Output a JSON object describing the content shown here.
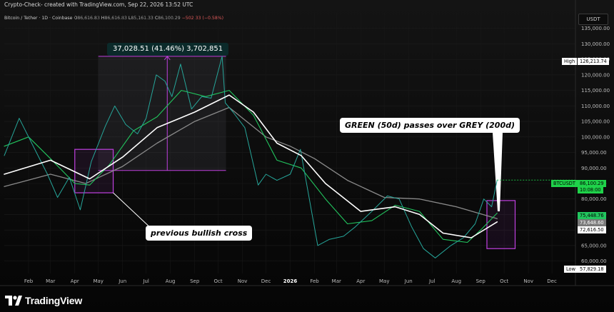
{
  "header": {
    "credit": "Crypto-Check- created with TradingView.com, Sep 22, 2026 13:52 UTC",
    "symbol": "Bitcoin / Tether · 1D · Coinbase",
    "ohlc": [
      {
        "k": "O",
        "v": "86,616.83"
      },
      {
        "k": "H",
        "v": "86,616.83"
      },
      {
        "k": "L",
        "v": "85,161.33"
      },
      {
        "k": "C",
        "v": "86,100.29"
      }
    ],
    "change": "−502.33 (−0.58%)"
  },
  "currency_label": "USDT",
  "logo_text": "TradingView",
  "colors": {
    "price": "#26a69a",
    "ma50": "#22c55e",
    "ma200": "#8a8a8a",
    "ma_white": "#ffffff",
    "magenta": "#c040e0",
    "last_price": "#1fd24a"
  },
  "price_labels": {
    "high_tag": "High",
    "high_value": "126,213.74",
    "low_tag": "Low",
    "low_value": "57,829.18",
    "symbol_tag": "BTCUSDT",
    "last_price": "86,100.29",
    "countdown": "10:08:00",
    "ma50_value": "75,448.76",
    "ma200_value": "73,648.60",
    "white_ma_value": "72,616.50"
  },
  "annotations": {
    "measure": "37,028.51 (41.46%) 3,702,851",
    "cross_note": "GREEN (50d) passes over GREY (200d)",
    "prev_note": "previous bullish cross"
  },
  "chart_data": {
    "type": "line",
    "title": "",
    "xlabel": "",
    "ylabel": "",
    "ylim": [
      56000,
      140000
    ],
    "y_ticks": [
      "135,000.00",
      "130,000.00",
      "125,000.00",
      "120,000.00",
      "115,000.00",
      "110,000.00",
      "105,000.00",
      "100,000.00",
      "95,000.00",
      "90,000.00",
      "85,000.00",
      "80,000.00",
      "75,000.00",
      "70,000.00",
      "65,000.00",
      "60,000.00"
    ],
    "x_ticks": [
      "Feb",
      "Mar",
      "Apr",
      "May",
      "Jun",
      "Jul",
      "Aug",
      "Sep",
      "Oct",
      "Nov",
      "Dec",
      "2026",
      "Feb",
      "Mar",
      "Apr",
      "May",
      "Jun",
      "Jul",
      "Aug",
      "Sep",
      "Oct",
      "Nov",
      "Dec"
    ],
    "x_start": "2025-01-01",
    "x_end": "2026-12-31",
    "series": [
      {
        "key": "price",
        "values": [
          [
            "2025-01-01",
            94000
          ],
          [
            "2025-01-20",
            106000
          ],
          [
            "2025-02-05",
            98000
          ],
          [
            "2025-02-25",
            88000
          ],
          [
            "2025-03-10",
            80500
          ],
          [
            "2025-03-25",
            87000
          ],
          [
            "2025-04-08",
            76500
          ],
          [
            "2025-04-22",
            92000
          ],
          [
            "2025-05-10",
            103500
          ],
          [
            "2025-05-22",
            110000
          ],
          [
            "2025-06-05",
            104000
          ],
          [
            "2025-06-20",
            101000
          ],
          [
            "2025-07-01",
            106000
          ],
          [
            "2025-07-14",
            120000
          ],
          [
            "2025-07-25",
            118000
          ],
          [
            "2025-08-03",
            113000
          ],
          [
            "2025-08-14",
            123500
          ],
          [
            "2025-08-28",
            109000
          ],
          [
            "2025-09-10",
            113000
          ],
          [
            "2025-09-22",
            112500
          ],
          [
            "2025-10-06",
            126000
          ],
          [
            "2025-10-10",
            111000
          ],
          [
            "2025-10-20",
            108000
          ],
          [
            "2025-11-04",
            103000
          ],
          [
            "2025-11-21",
            84500
          ],
          [
            "2025-12-01",
            88000
          ],
          [
            "2025-12-15",
            86000
          ],
          [
            "2026-01-01",
            88000
          ],
          [
            "2026-01-14",
            96000
          ],
          [
            "2026-02-05",
            65000
          ],
          [
            "2026-02-20",
            67000
          ],
          [
            "2026-03-10",
            68000
          ],
          [
            "2026-03-25",
            71000
          ],
          [
            "2026-04-15",
            76000
          ],
          [
            "2026-05-05",
            81000
          ],
          [
            "2026-05-20",
            80000
          ],
          [
            "2026-06-05",
            71000
          ],
          [
            "2026-06-20",
            64000
          ],
          [
            "2026-07-05",
            61000
          ],
          [
            "2026-07-25",
            65000
          ],
          [
            "2026-08-10",
            67500
          ],
          [
            "2026-08-25",
            72000
          ],
          [
            "2026-09-05",
            80000
          ],
          [
            "2026-09-15",
            77500
          ],
          [
            "2026-09-22",
            86100
          ]
        ]
      },
      {
        "key": "ma50",
        "values": [
          [
            "2025-01-01",
            97000
          ],
          [
            "2025-02-01",
            100000
          ],
          [
            "2025-03-01",
            93000
          ],
          [
            "2025-04-01",
            85000
          ],
          [
            "2025-04-20",
            84500
          ],
          [
            "2025-05-15",
            91000
          ],
          [
            "2025-06-15",
            102000
          ],
          [
            "2025-07-15",
            106500
          ],
          [
            "2025-08-15",
            115000
          ],
          [
            "2025-09-15",
            113000
          ],
          [
            "2025-10-15",
            115000
          ],
          [
            "2025-11-15",
            107000
          ],
          [
            "2025-12-15",
            92500
          ],
          [
            "2026-01-15",
            90000
          ],
          [
            "2026-02-15",
            80000
          ],
          [
            "2026-03-15",
            72000
          ],
          [
            "2026-04-15",
            73000
          ],
          [
            "2026-05-15",
            78000
          ],
          [
            "2026-06-15",
            76000
          ],
          [
            "2026-07-15",
            67000
          ],
          [
            "2026-08-15",
            66000
          ],
          [
            "2026-09-01",
            70000
          ],
          [
            "2026-09-22",
            75449
          ]
        ]
      },
      {
        "key": "ma200",
        "values": [
          [
            "2025-01-01",
            84000
          ],
          [
            "2025-03-01",
            88000
          ],
          [
            "2025-04-15",
            85000
          ],
          [
            "2025-06-01",
            90500
          ],
          [
            "2025-07-15",
            98000
          ],
          [
            "2025-09-01",
            105000
          ],
          [
            "2025-10-15",
            109500
          ],
          [
            "2025-12-01",
            100000
          ],
          [
            "2026-01-01",
            97000
          ],
          [
            "2026-02-01",
            93000
          ],
          [
            "2026-03-15",
            86000
          ],
          [
            "2026-05-01",
            80500
          ],
          [
            "2026-06-15",
            80000
          ],
          [
            "2026-08-01",
            77500
          ],
          [
            "2026-09-22",
            73649
          ]
        ]
      },
      {
        "key": "ma_white",
        "values": [
          [
            "2025-01-01",
            88000
          ],
          [
            "2025-03-01",
            92500
          ],
          [
            "2025-04-20",
            86500
          ],
          [
            "2025-06-01",
            93500
          ],
          [
            "2025-07-15",
            103000
          ],
          [
            "2025-09-01",
            108000
          ],
          [
            "2025-10-15",
            113500
          ],
          [
            "2025-11-15",
            108000
          ],
          [
            "2025-12-15",
            98000
          ],
          [
            "2026-01-15",
            94000
          ],
          [
            "2026-02-15",
            85000
          ],
          [
            "2026-04-01",
            76000
          ],
          [
            "2026-05-15",
            77500
          ],
          [
            "2026-06-15",
            75000
          ],
          [
            "2026-07-15",
            69000
          ],
          [
            "2026-08-20",
            67500
          ],
          [
            "2026-09-22",
            72617
          ]
        ]
      }
    ]
  }
}
